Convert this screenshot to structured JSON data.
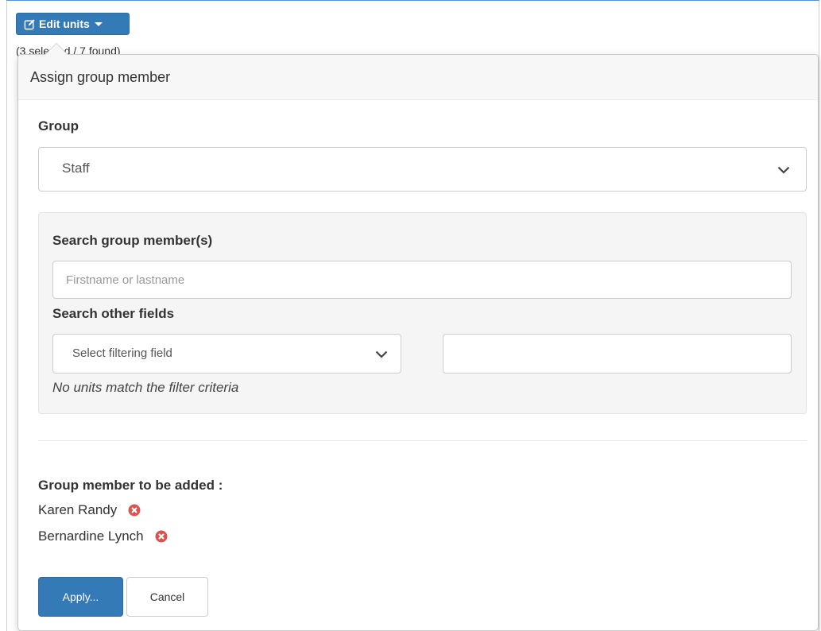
{
  "toolbar": {
    "edit_units_label": "Edit units",
    "selection_status": "(3 selected / 7 found)"
  },
  "popover": {
    "title": "Assign group member",
    "group_label": "Group",
    "group_value": "Staff",
    "search_label": "Search group member(s)",
    "search_placeholder": "Firstname or lastname",
    "other_fields_label": "Search other fields",
    "filter_field_value": "Select filtering field",
    "filter_value": "",
    "no_match_message": "No units match the filter criteria",
    "to_add_label": "Group member to be added :",
    "members": [
      {
        "name": "Karen Randy"
      },
      {
        "name": "Bernardine Lynch"
      }
    ],
    "apply_label": "Apply...",
    "cancel_label": "Cancel"
  },
  "icons": {
    "edit": "edit-icon",
    "caret": "caret-down-icon",
    "chevron": "chevron-down-icon",
    "remove": "remove-circle-icon"
  },
  "colors": {
    "primary": "#337ab7",
    "danger": "#d9534f",
    "header_bg": "#f7f7f7",
    "well_bg": "#f5f5f5"
  }
}
